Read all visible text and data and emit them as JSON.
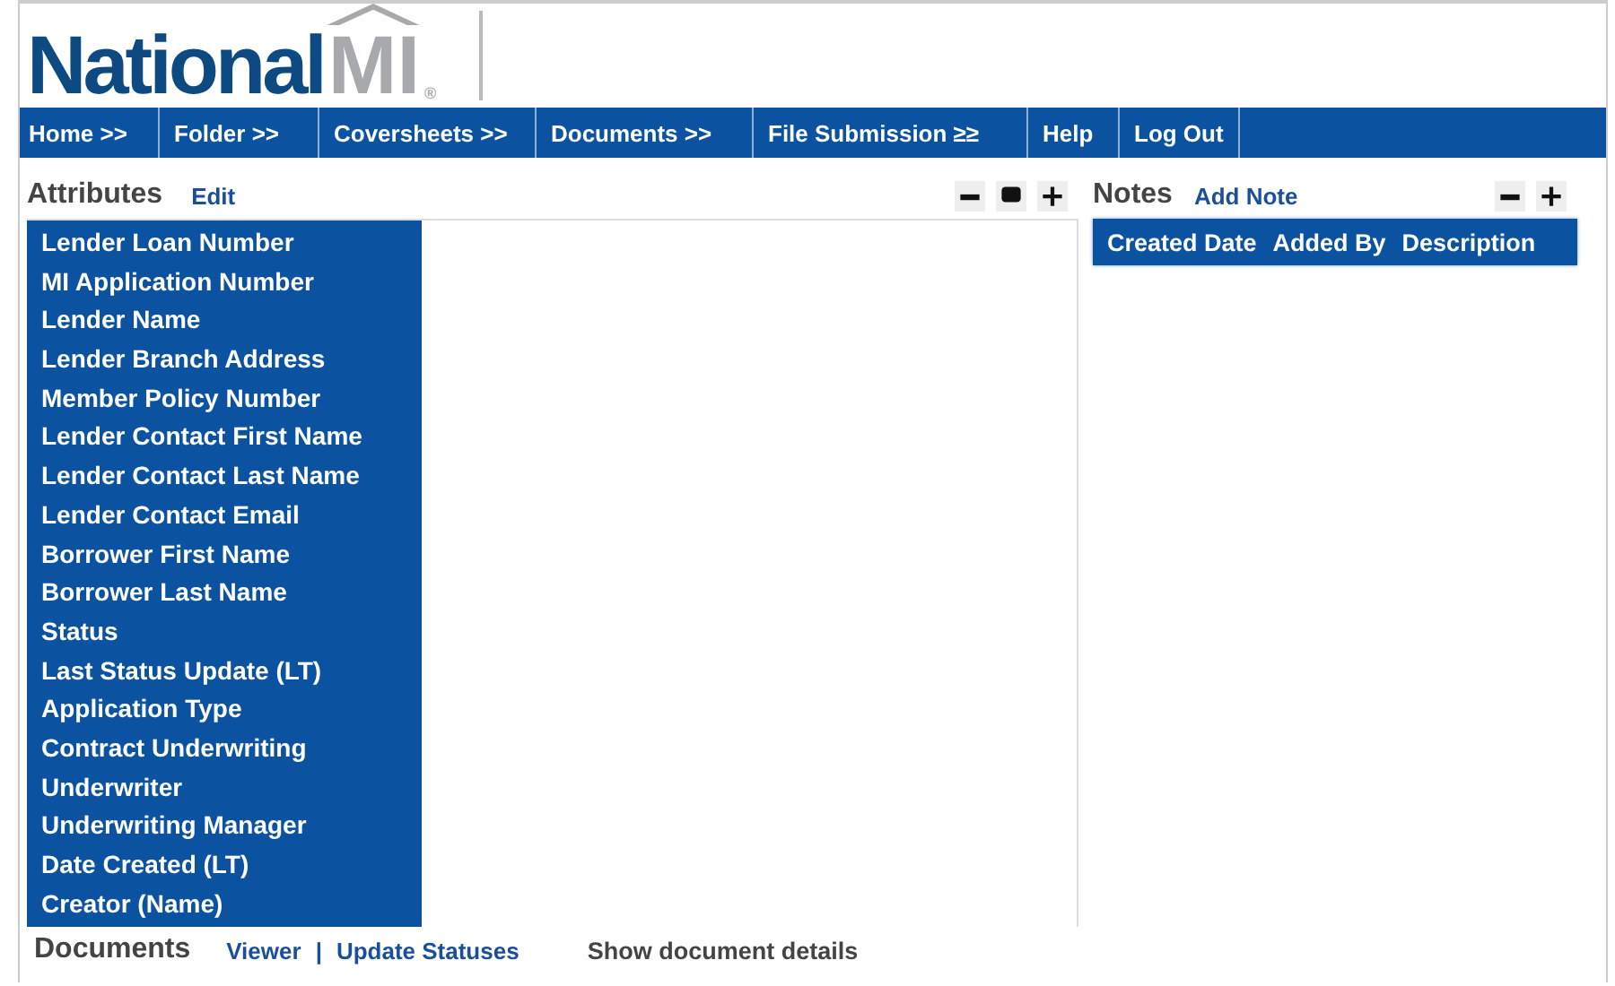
{
  "logo": {
    "word": "National",
    "mark": "MI",
    "registered": "®"
  },
  "nav": [
    {
      "label": "Home >>"
    },
    {
      "label": "Folder >>"
    },
    {
      "label": "Coversheets >>"
    },
    {
      "label": "Documents >>"
    },
    {
      "label": "File Submission ≥≥"
    },
    {
      "label": "Help"
    },
    {
      "label": "Log Out"
    }
  ],
  "attributes": {
    "title": "Attributes",
    "action": "Edit",
    "fields": [
      "Lender Loan Number",
      "MI Application Number",
      "Lender Name",
      "Lender Branch Address",
      "Member Policy Number",
      "Lender Contact First Name",
      "Lender Contact Last Name",
      "Lender Contact Email",
      "Borrower First Name",
      "Borrower Last Name",
      "Status",
      "Last Status Update (LT)",
      "Application Type",
      "Contract Underwriting",
      "Underwriter",
      "Underwriting Manager",
      "Date Created (LT)",
      "Creator (Name)"
    ]
  },
  "notes": {
    "title": "Notes",
    "action": "Add Note",
    "columns": [
      "Created Date",
      "Added By",
      "Description"
    ]
  },
  "documents": {
    "title": "Documents",
    "links": [
      "Viewer",
      "Update Statuses"
    ],
    "separator": "|",
    "details": "Show document details"
  }
}
